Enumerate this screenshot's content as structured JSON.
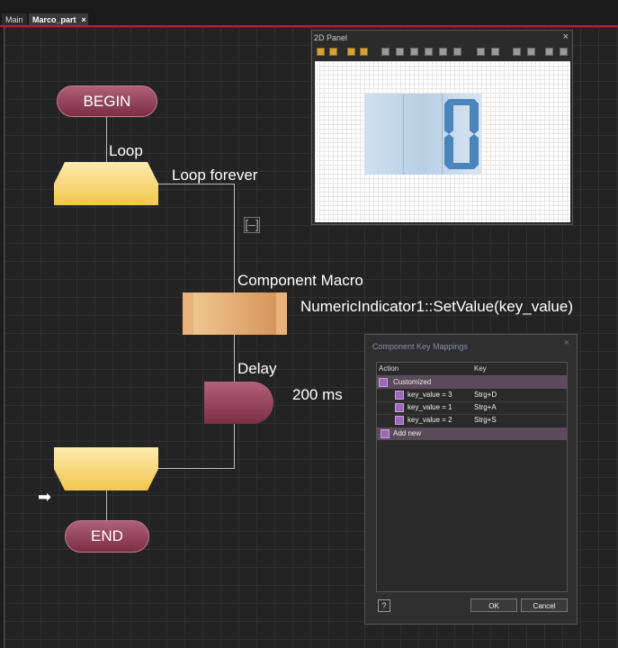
{
  "tabs": [
    {
      "label": "Main"
    },
    {
      "label": "Marco_part",
      "close": "×"
    }
  ],
  "flowchart": {
    "begin_label": "BEGIN",
    "loop_label": "Loop",
    "loop_condition": "Loop forever",
    "collapse_symbol": "[–]",
    "macro_title": "Component Macro",
    "macro_call": "NumericIndicator1::SetValue(key_value)",
    "delay_title": "Delay",
    "delay_value": "200 ms",
    "end_label": "END",
    "pointer_icon": "arrow-right-icon"
  },
  "panel2d": {
    "title": "2D Panel",
    "close": "×",
    "display_digit": "0",
    "digit_color": "#4a84bb"
  },
  "key_mappings": {
    "title": "Component Key Mappings",
    "close": "×",
    "columns": {
      "action": "Action",
      "key": "Key"
    },
    "group": "Customized",
    "rows": [
      {
        "action": "key_value = 3",
        "key": "Strg+D"
      },
      {
        "action": "key_value = 1",
        "key": "Strg+A"
      },
      {
        "action": "key_value = 2",
        "key": "Strg+S"
      }
    ],
    "add_new": "Add new",
    "help": "?",
    "ok": "OK",
    "cancel": "Cancel"
  },
  "colors": {
    "accent": "#b0262f",
    "begin_end": "#8c3b55",
    "loop": "#f6d36a",
    "macro": "#e0a56a"
  }
}
